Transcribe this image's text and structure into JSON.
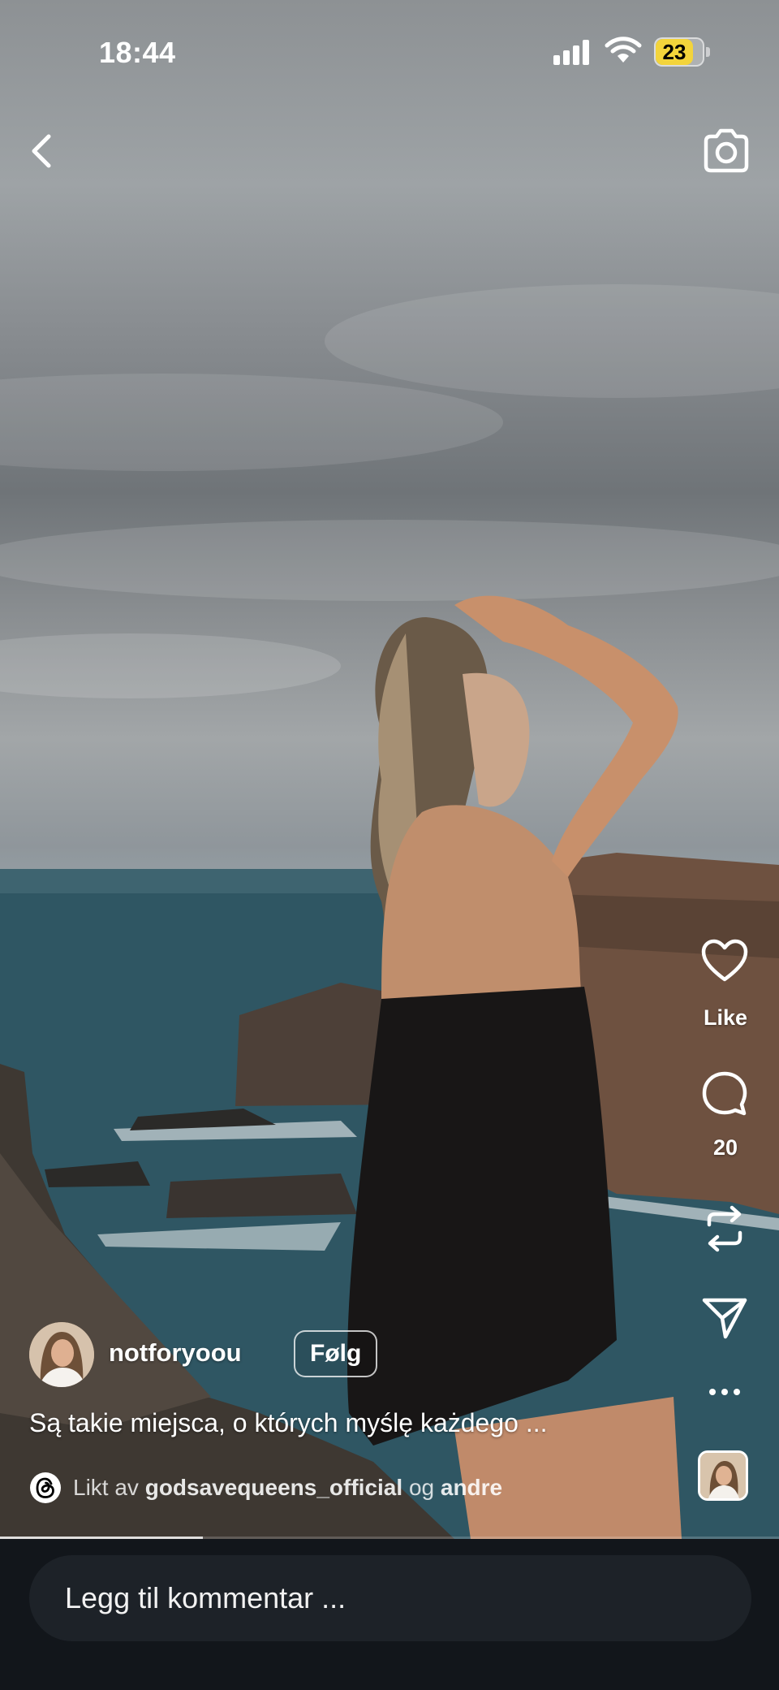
{
  "status_bar": {
    "time": "18:44",
    "battery": "23"
  },
  "post": {
    "username": "notforyoou",
    "follow_label": "Følg",
    "caption": "Są takie miejsca, o których myślę każdego ...",
    "liked_by": {
      "prefix": "Likt av",
      "user": "godsavequeens_official",
      "conjunction": "og",
      "others": "andre"
    }
  },
  "actions": {
    "like_label": "Like",
    "comments_count": "20"
  },
  "comment_bar": {
    "placeholder": "Legg til kommentar ..."
  },
  "playback": {
    "progress": 0.26
  },
  "icons": {
    "back": "chevron-left-icon",
    "camera": "camera-icon",
    "like": "heart-icon",
    "comment": "speech-bubble-icon",
    "repost": "repost-icon",
    "share": "paper-plane-icon",
    "more": "more-dots-icon",
    "liked_by": "threads-icon"
  }
}
